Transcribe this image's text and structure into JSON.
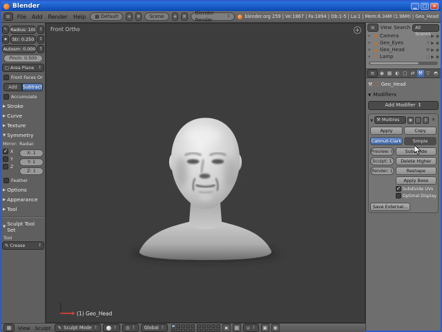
{
  "window": {
    "title": "Blender"
  },
  "info_bar": {
    "menus": [
      "File",
      "Add",
      "Render",
      "Help"
    ],
    "layout_value": "Default",
    "scene_value": "Scene",
    "engine_value": "Blender Render",
    "stats": "blender.org 259 | Ve:1867 | Fa:1894 | Ob:1-5 | La:1 | Mem:6.34M (1.96M) | Geo_Head"
  },
  "tool_shelf": {
    "sliders": {
      "radius": "Radius: 100",
      "strength": "Str: 0.250",
      "autosmooth": "Autosm: 0.000",
      "pinch": "Pinch: 0.500"
    },
    "area_plane": "Area Plane",
    "front_faces_only": "Front Faces Only",
    "add_label": "Add",
    "subtract_label": "Subtract",
    "accumulate": "Accumulate",
    "panels1": [
      "Stroke",
      "Curve",
      "Texture"
    ],
    "symmetry": {
      "title": "Symmetry",
      "mirror_label": "Mirror:",
      "radial_label": "Radial:",
      "x": "X",
      "y": "Y",
      "z": "Z",
      "radial_x": "X: 1",
      "radial_y": "Y: 1",
      "radial_z": "Z: 1",
      "feather": "Feather"
    },
    "panels2": [
      "Options",
      "Appearance",
      "Tool"
    ],
    "tool_set": {
      "title": "Sculpt Tool Set",
      "tool_label": "Tool",
      "tool_value": "Crease"
    }
  },
  "viewport": {
    "view_label": "Front Ortho",
    "object_label": "(1) Geo_Head"
  },
  "outliner": {
    "menu_view": "View",
    "menu_search": "Search",
    "scope": "All Scenes",
    "items": [
      {
        "name": "Camera"
      },
      {
        "name": "Geo_Eyes"
      },
      {
        "name": "Geo_Head"
      },
      {
        "name": "Lamp"
      }
    ]
  },
  "properties": {
    "breadcrumb_object": "Geo_Head",
    "panel_title": "Modifiers",
    "add_modifier": "Add Modifier",
    "modifier": {
      "name": "Multires",
      "apply": "Apply",
      "copy": "Copy",
      "catmull_clark": "Catmull-Clark",
      "simple": "Simple",
      "preview": "Preview: 0",
      "sculpt": "Sculpt: 1",
      "render": "Render: 1",
      "subdivide": "Subdivide",
      "delete_higher": "Delete Higher",
      "reshape": "Reshape",
      "apply_base": "Apply Base",
      "subdivide_uvs": "Subdivide UVs",
      "optimal_display": "Optimal Display",
      "save_external": "Save External..."
    }
  },
  "view3d_header": {
    "menu_view": "View",
    "menu_sculpt": "Sculpt",
    "mode": "Sculpt Mode",
    "orientation": "Global"
  },
  "colors": {
    "selection_blue": "#40659f",
    "viewport_bg": "#3d3d3d",
    "titlebar_blue": "#0c48b0"
  }
}
